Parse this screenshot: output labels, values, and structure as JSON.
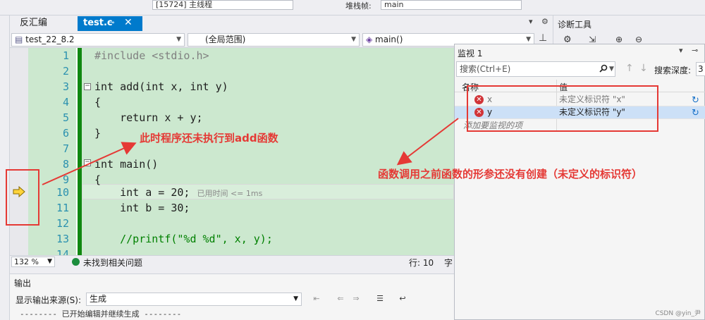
{
  "topbar": {
    "box1": "[15724] 主线程",
    "label": "堆栈帧:",
    "box2": "main"
  },
  "tabs": {
    "disassembly": "反汇编",
    "active_file": "test.c",
    "pin_glyph": "⊸",
    "close_glyph": "✕"
  },
  "navbar": {
    "project": "test_22_8.2",
    "scope": "(全局范围)",
    "function": "main()"
  },
  "editor": {
    "lines": [
      {
        "n": "1",
        "code": "#include <stdio.h>"
      },
      {
        "n": "2",
        "code": ""
      },
      {
        "n": "3",
        "code": "int add(int x, int y)"
      },
      {
        "n": "4",
        "code": "{"
      },
      {
        "n": "5",
        "code": "    return x + y;"
      },
      {
        "n": "6",
        "code": "}"
      },
      {
        "n": "7",
        "code": ""
      },
      {
        "n": "8",
        "code": "int main()"
      },
      {
        "n": "9",
        "code": "{"
      },
      {
        "n": "10",
        "code": "    int a = 20;"
      },
      {
        "n": "11",
        "code": "    int b = 30;"
      },
      {
        "n": "12",
        "code": ""
      },
      {
        "n": "13",
        "code": "    //printf(\"%d %d\", x, y);"
      },
      {
        "n": "14",
        "code": ""
      }
    ],
    "elapsed_hint": "已用时间 <= 1ms"
  },
  "status": {
    "zoom": "132 %",
    "issues": "未找到相关问题",
    "position": "行: 10",
    "char_label": "字"
  },
  "output": {
    "title": "输出",
    "source_label": "显示输出来源(S):",
    "source_value": "生成",
    "line": "-------- 已开始编辑并继续生成 --------"
  },
  "diagnostics": {
    "title": "诊断工具"
  },
  "watch": {
    "title": "监视 1",
    "search_placeholder": "搜索(Ctrl+E)",
    "depth_label": "搜索深度:",
    "depth_value": "3",
    "col_name": "名称",
    "col_value": "值",
    "rows": [
      {
        "name": "x",
        "value": "未定义标识符 \"x\""
      },
      {
        "name": "y",
        "value": "未定义标识符 \"y\""
      }
    ],
    "add_placeholder": "添加要监视的项"
  },
  "annotations": {
    "left_note": "此时程序还未执行到add函数",
    "right_note": "函数调用之前函数的形参还没有创建（未定义的标识符）",
    "color": "#e53935"
  },
  "watermark": "CSDN @yin_尹",
  "colors": {
    "accent": "#007acc",
    "editor_bg": "#cce8cf",
    "change_bar": "#108810",
    "keyword": "#0000ff"
  }
}
